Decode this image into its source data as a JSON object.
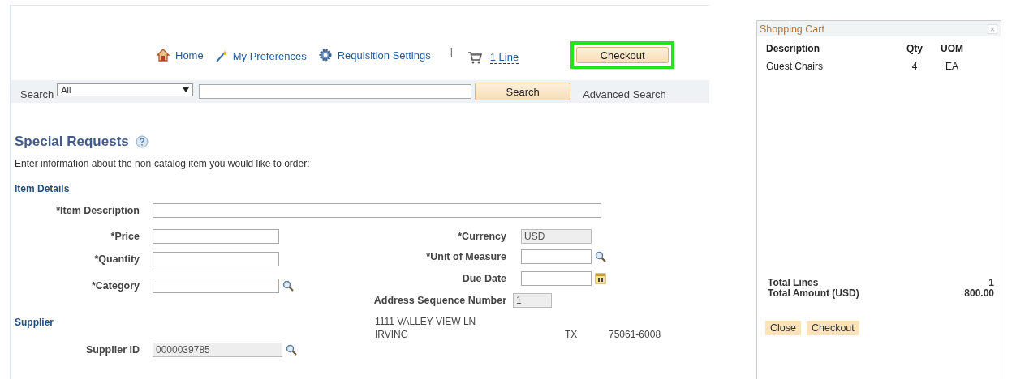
{
  "nav": {
    "links": [
      {
        "label": "Home"
      },
      {
        "label": "My Preferences"
      },
      {
        "label": "Requisition Settings"
      }
    ],
    "separator": "|",
    "cart_link": "1 Line",
    "checkout": {
      "label": "Checkout",
      "highlighted": true
    }
  },
  "search": {
    "label": "Search",
    "category": "All",
    "button": "Search",
    "advanced": "Advanced Search"
  },
  "page": {
    "title": "Special Requests",
    "instruction": "Enter information about the non-catalog item you would like to order:",
    "section": "Item Details",
    "item_description": {
      "label": "*Item Description",
      "disabled": false
    },
    "left_fields": [
      {
        "label": "*Price",
        "disabled": false,
        "kind": "text"
      },
      {
        "label": "*Quantity",
        "disabled": false,
        "kind": "text"
      },
      {
        "label": "*Category",
        "disabled": false,
        "kind": "lookup"
      }
    ],
    "right_fields": [
      {
        "label": "*Currency",
        "value": "USD",
        "disabled": true,
        "kind": "text"
      },
      {
        "label": "*Unit of Measure",
        "disabled": false,
        "kind": "lookup"
      },
      {
        "label": "Due Date",
        "disabled": false,
        "kind": "date"
      },
      {
        "label": "Address Sequence Number",
        "value": "1",
        "disabled": true,
        "kind": "number"
      }
    ],
    "supplier": {
      "heading": "Supplier",
      "id_label": "Supplier ID",
      "id_value": "0000039785",
      "id_disabled": true,
      "address_line": "1111 VALLEY VIEW LN",
      "city": "IRVING",
      "state": "TX",
      "zip": "75061-6008"
    }
  },
  "cart": {
    "title": "Shopping Cart",
    "close": "×",
    "columns": [
      "Description",
      "Qty",
      "UOM"
    ],
    "rows": [
      [
        "Guest Chairs",
        "4",
        "EA"
      ]
    ],
    "totals": [
      {
        "label": "Total Lines",
        "value": "1"
      },
      {
        "label": "Total Amount (USD)",
        "value": "800.00"
      }
    ],
    "buttons": [
      "Close",
      "Checkout"
    ]
  }
}
